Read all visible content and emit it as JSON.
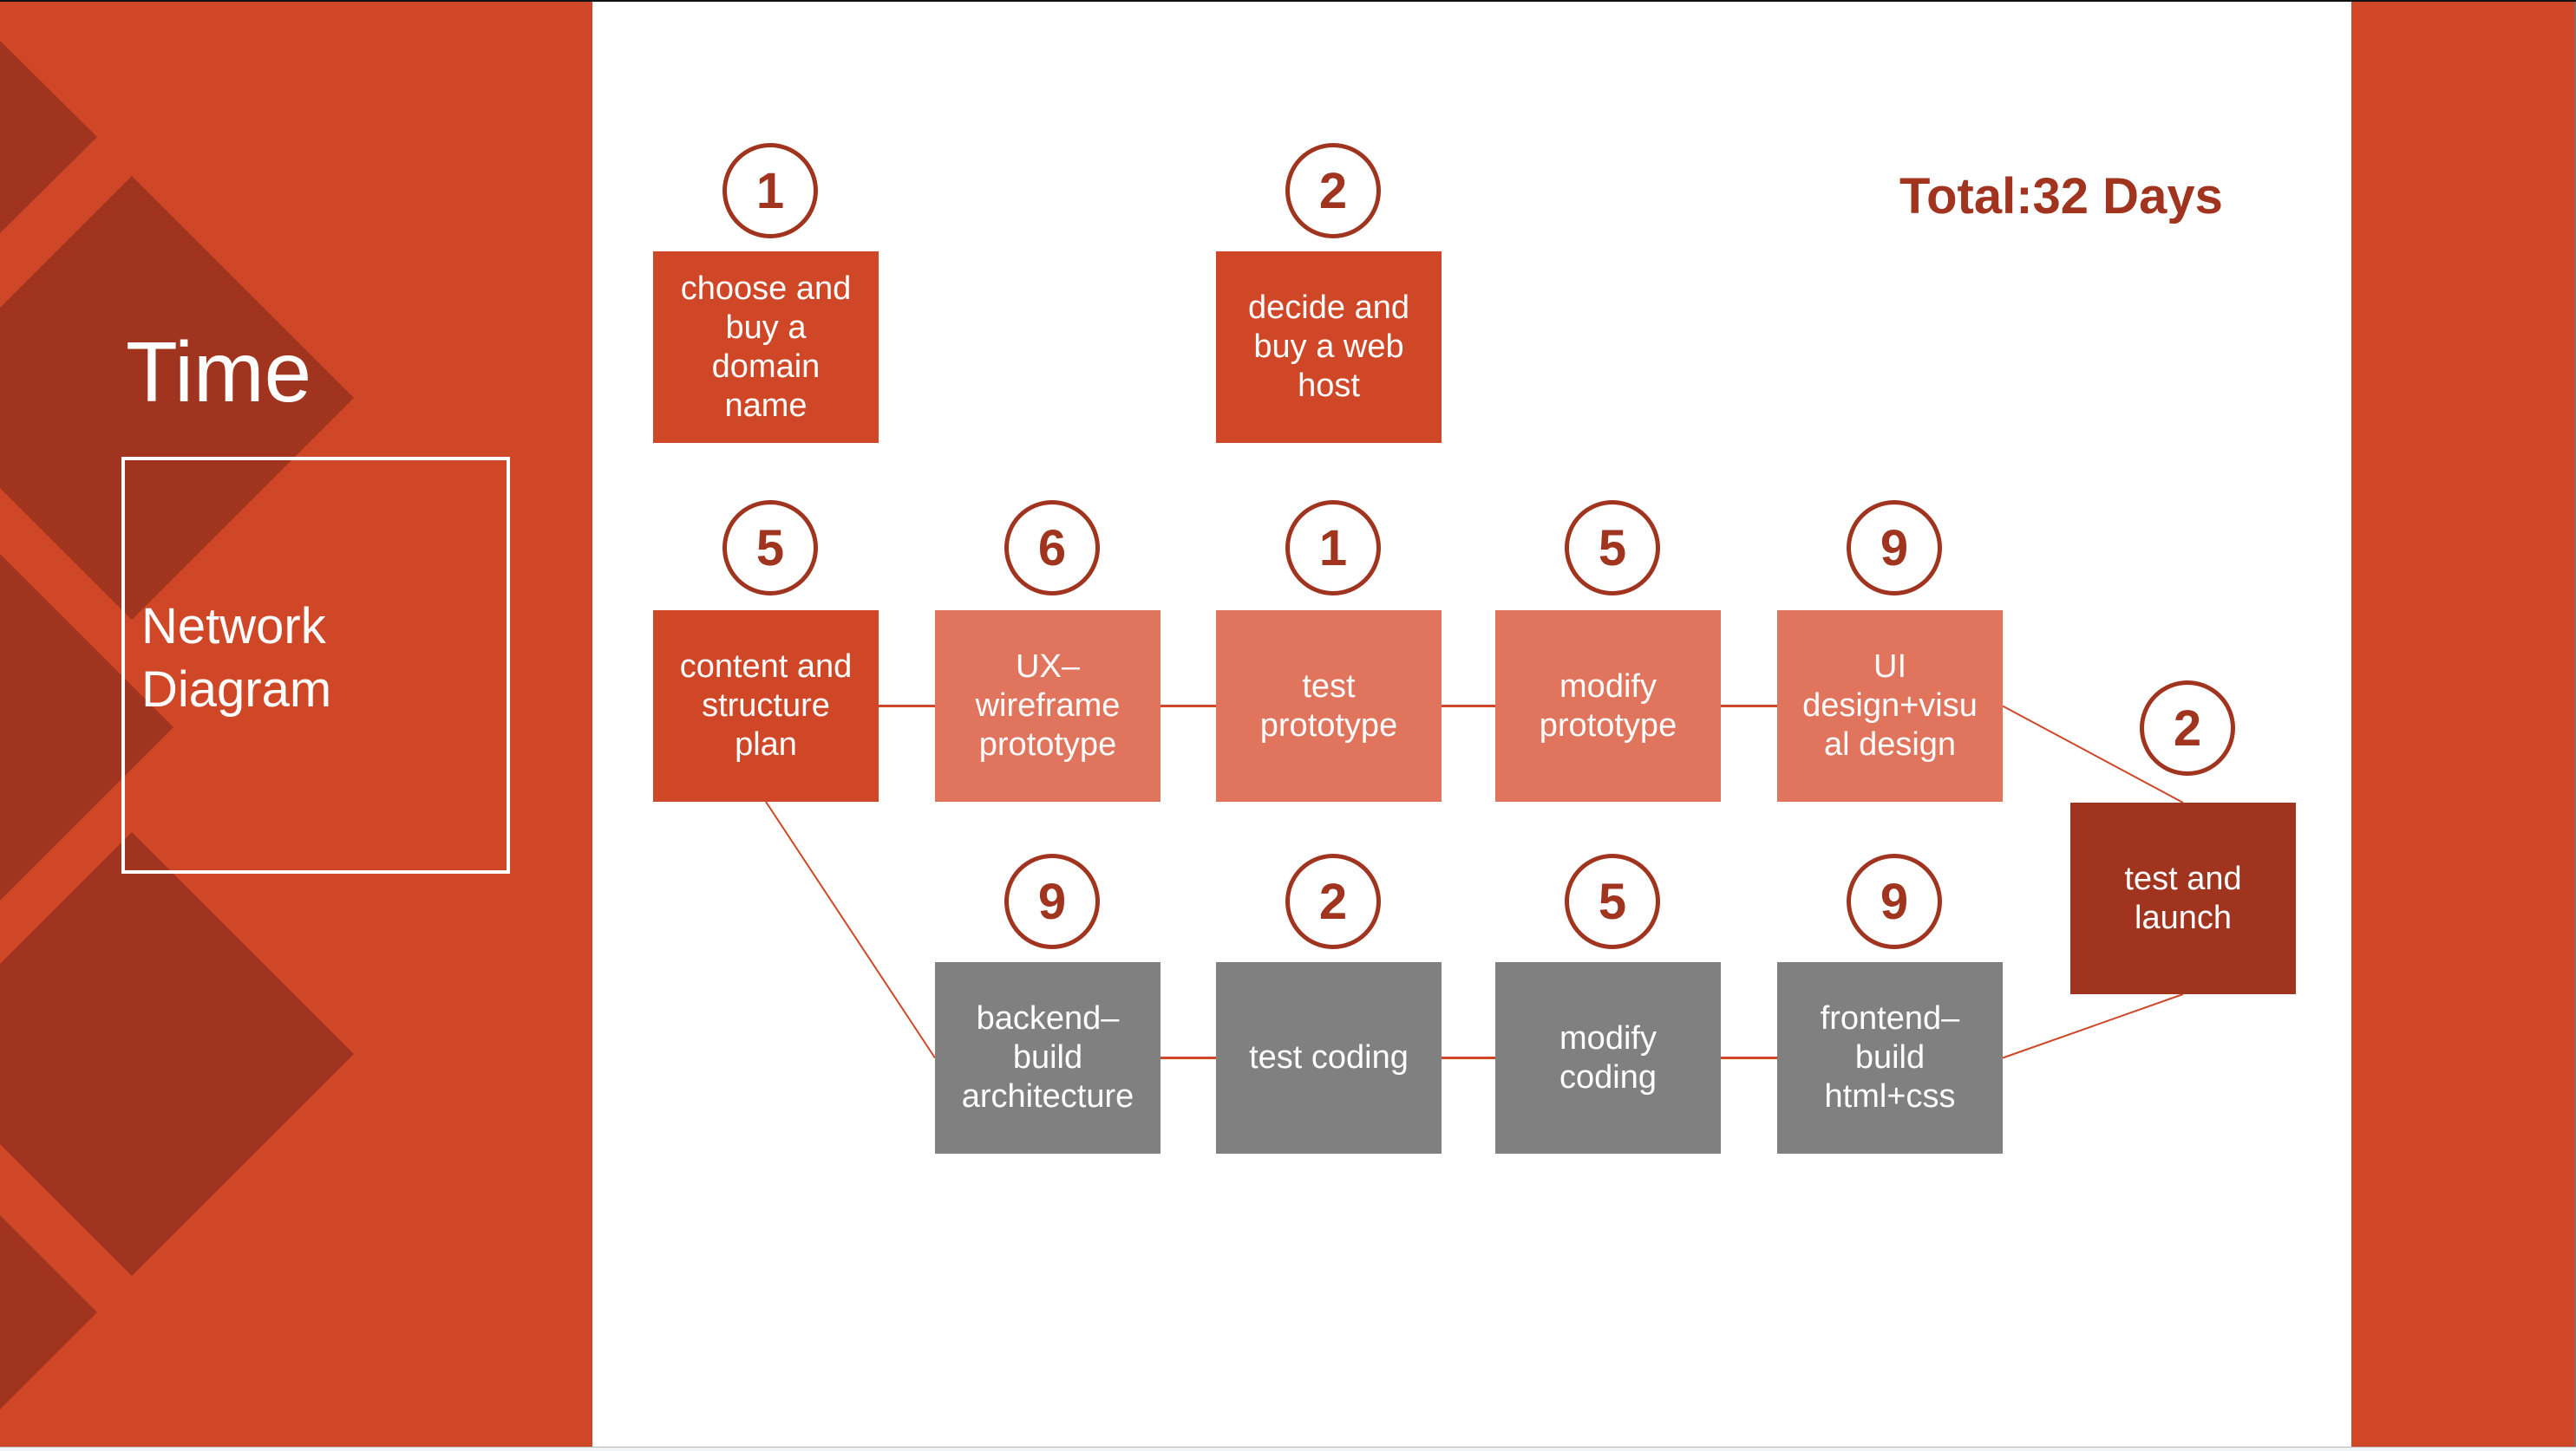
{
  "slide": {
    "title": "Time",
    "subtitle": "Network\nDiagram",
    "total_label": "Total:32 Days"
  },
  "colors": {
    "primary": "#d04727",
    "dark": "#a0341f",
    "light": "#e0745c",
    "gray": "#808080",
    "white": "#ffffff"
  },
  "tasks": [
    {
      "id": "domain",
      "label": "choose and\nbuy a\ndomain\nname",
      "days": "1",
      "style": "dark"
    },
    {
      "id": "host",
      "label": "decide and\nbuy a web\nhost",
      "days": "2",
      "style": "dark"
    },
    {
      "id": "content",
      "label": "content and\nstructure\nplan",
      "days": "5",
      "style": "dark"
    },
    {
      "id": "ux",
      "label": "UX–\nwireframe\nprototype",
      "days": "6",
      "style": "light"
    },
    {
      "id": "test-proto",
      "label": "test\nprototype",
      "days": "1",
      "style": "light"
    },
    {
      "id": "modify-proto",
      "label": "modify\nprototype",
      "days": "5",
      "style": "light"
    },
    {
      "id": "ui",
      "label": "UI\ndesign+visu\nal design",
      "days": "9",
      "style": "light"
    },
    {
      "id": "backend",
      "label": "backend–\nbuild\narchitecture",
      "days": "9",
      "style": "gray"
    },
    {
      "id": "test-coding",
      "label": "test coding",
      "days": "2",
      "style": "gray"
    },
    {
      "id": "modify-coding",
      "label": "modify\ncoding",
      "days": "5",
      "style": "gray"
    },
    {
      "id": "frontend",
      "label": "frontend–\nbuild\nhtml+css",
      "days": "9",
      "style": "gray"
    },
    {
      "id": "launch",
      "label": "test and\nlaunch",
      "days": "2",
      "style": "final"
    }
  ],
  "edges": [
    [
      "content",
      "ux"
    ],
    [
      "ux",
      "test-proto"
    ],
    [
      "test-proto",
      "modify-proto"
    ],
    [
      "modify-proto",
      "ui"
    ],
    [
      "ui",
      "launch"
    ],
    [
      "content",
      "backend"
    ],
    [
      "backend",
      "test-coding"
    ],
    [
      "test-coding",
      "modify-coding"
    ],
    [
      "modify-coding",
      "frontend"
    ],
    [
      "frontend",
      "launch"
    ]
  ]
}
